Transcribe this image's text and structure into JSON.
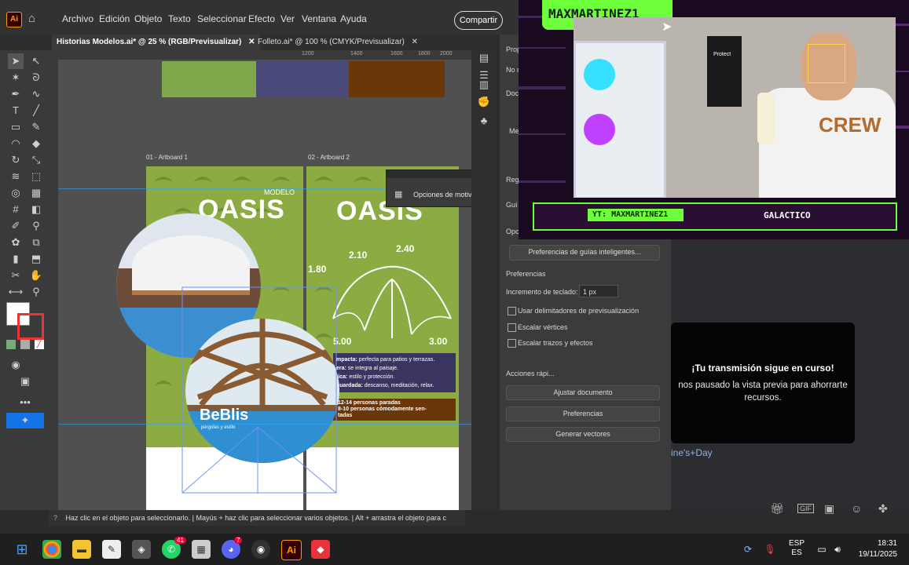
{
  "menubar": {
    "logo": "Ai",
    "items": [
      "Archivo",
      "Edición",
      "Objeto",
      "Texto",
      "Seleccionar",
      "Efecto",
      "Ver",
      "Ventana",
      "Ayuda"
    ],
    "share_label": "Compartir"
  },
  "tabs": [
    {
      "label": "Historias Modelos.ai* @ 25 % (RGB/Previsualizar)"
    },
    {
      "label": "Folleto.ai* @ 100 % (CMYK/Previsualizar)"
    }
  ],
  "ruler_marks": [
    "1200",
    "1400",
    "1600",
    "1800",
    "2000"
  ],
  "canvas": {
    "swatches": [
      "#7fa84a",
      "#4a4a7a",
      "#6b3608"
    ],
    "artboard1_label": "01 - Artboard 1",
    "artboard2_label": "02 - Artboard 2",
    "modelo": "MODELO",
    "oasis": "OASIS",
    "dims": [
      "2.10",
      "2.40",
      "1.80",
      "5.00",
      "3.00"
    ],
    "features": [
      {
        "k": "mpacta:",
        "v": "perfecta para patios y terrazas."
      },
      {
        "k": "era:",
        "v": "se integra al paisaje."
      },
      {
        "k": "tica:",
        "v": "estilo y protección."
      },
      {
        "k": "guardada:",
        "v": "descanso, meditación, relax."
      }
    ],
    "capacity_1": "12-14 personas paradas",
    "capacity_2": "8-10 personas cómodamente sen-",
    "capacity_3": "tadas",
    "brand": "BeBlis",
    "brand_sub": "pérgolas y estilo",
    "motif_options": "Opciones de motivo"
  },
  "properties": {
    "tab_labels": [
      "Prop",
      "No n",
      "Doc",
      "Me",
      "Reg",
      "Guí",
      "Opc"
    ],
    "smart_guides_button": "Preferencias de guías inteligentes...",
    "preferences_heading": "Preferencias",
    "keyboard_increment_label": "Incremento de teclado:",
    "keyboard_increment_value": "1 px",
    "checkboxes": [
      "Usar delimitadores de previsualización",
      "Escalar vértices",
      "Escalar trazos y efectos"
    ],
    "quick_actions": "Acciones rápi...",
    "buttons": [
      "Ajustar documento",
      "Preferencias",
      "Generar vectores"
    ]
  },
  "overlay": {
    "streamer_name": "MAXMARTINEZ1",
    "yt_label": "YT: MAXMARTINEZ1",
    "tag": "GALACTICO",
    "shirt_text": "Protect",
    "tshirt_text": "CREW"
  },
  "stream_notice": {
    "title": "¡Tu transmisión sigue en curso!",
    "body": "nos pausado la vista previa para ahorrarte recursos.",
    "link": "ine's+Day"
  },
  "status_bar": {
    "text": "Haz clic en el objeto para seleccionarlo. | Mayús + haz clic para seleccionar varios objetos. | Alt + arrastra el objeto para c"
  },
  "taskbar": {
    "lang_1": "ESP",
    "lang_2": "ES",
    "time": "18:31",
    "date": "19/11/2025",
    "whatsapp_badge": "41",
    "discord_badge": "7"
  },
  "colors": {
    "artboard_green": "#8cac43",
    "neon_green": "#6cff3a",
    "illustrator_orange": "#ff9a00",
    "panel_dark": "#3b3b3b"
  }
}
